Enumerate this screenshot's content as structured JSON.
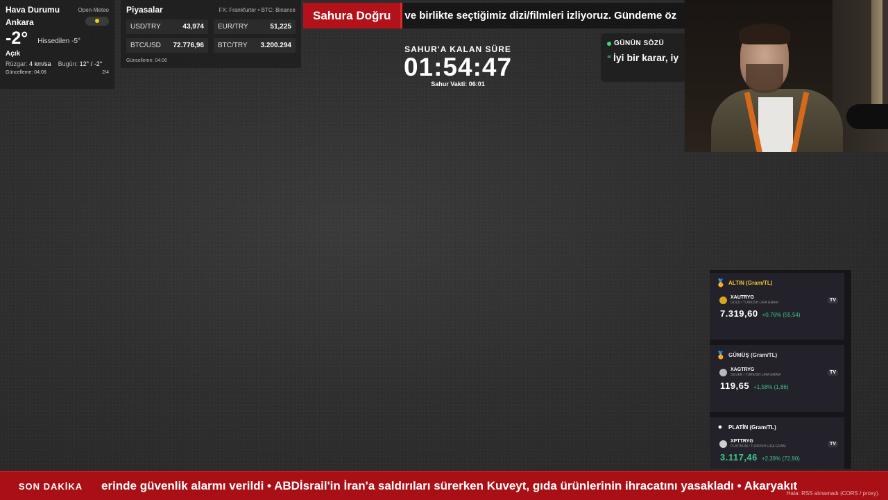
{
  "weather": {
    "title": "Hava Durumu",
    "source": "Open-Meteo",
    "city": "Ankara",
    "icon": "sun-icon",
    "temp": "-2°",
    "feels": "Hissedilen -5°",
    "condition": "Açık",
    "wind_label": "Rüzgar:",
    "wind_value": "4 km/sa",
    "today_label": "Bugün:",
    "today_value": "12° / -2°",
    "updated": "Güncelleme: 04:06",
    "page": "2/4"
  },
  "markets": {
    "title": "Piyasalar",
    "source": "FX: Frankfurter • BTC: Binance",
    "items": [
      {
        "label": "USD/TRY",
        "value": "43,974"
      },
      {
        "label": "EUR/TRY",
        "value": "51,225"
      },
      {
        "label": "BTC/USD",
        "value": "72.776,96"
      },
      {
        "label": "BTC/TRY",
        "value": "3.200.294"
      }
    ],
    "updated": "Güncelleme: 04:06"
  },
  "banner": {
    "label": "Sahura Doğru",
    "text": "ve birlikte seçtiğimiz dizi/filmleri izliyoruz. Gündeme öz"
  },
  "countdown": {
    "label": "SAHUR'A KALAN SÜRE",
    "time": "01:54:47",
    "sub": "Sahur Vakti: 06:01"
  },
  "quote": {
    "heading": "GÜNÜN SÖZÜ",
    "mark": "“",
    "text": "İyi bir karar, iy"
  },
  "metals": [
    {
      "title": "ALTIN (Gram/TL)",
      "icon": "medal-icon",
      "symbol": "XAUTRYG",
      "desc": "GOLD / TURKISH LIRA GRAM",
      "price": "7.319,60",
      "change": "+0,76% (55,54)",
      "tv": "TV"
    },
    {
      "title": "GÜMÜŞ (Gram/TL)",
      "icon": "medal-icon",
      "symbol": "XAGTRYG",
      "desc": "SILVER / TURKISH LIRA GRAM",
      "price": "119,65",
      "change": "+1,58% (1,86)",
      "tv": "TV"
    },
    {
      "title": "PLATİN (Gram/TL)",
      "icon": "circle-icon",
      "symbol": "XPTTRYG",
      "desc": "PLATINUM / TURKISH LIRA GRAM",
      "price": "3.117,46",
      "change": "+2,39% (72,90)",
      "tv": "TV"
    }
  ],
  "ticker": {
    "label": "SON DAKİKA",
    "text": "erinde güvenlik alarmı verildi   •   ABDİsrail'in İran'a saldırıları sürerken Kuveyt, gıda ürünlerinin ihracatını yasakladı   •   Akaryakıt",
    "error": "Hata: RSS alınamadı (CORS / proxy)."
  },
  "colors": {
    "accent_red": "#a91016",
    "positive_green": "#3ec48a",
    "gold": "#f1c232"
  }
}
